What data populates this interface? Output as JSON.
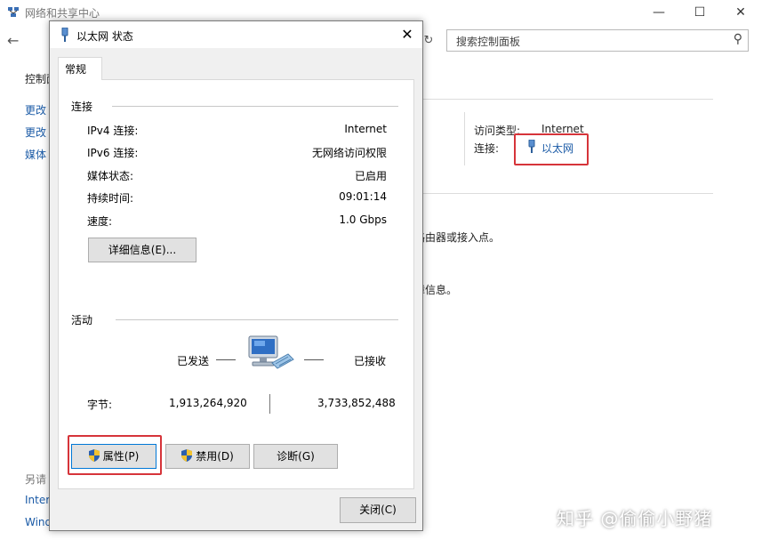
{
  "background": {
    "title": "网络和共享中心",
    "search_placeholder": "搜索控制面板",
    "left_items": [
      "控制面",
      "更改",
      "更改",
      "媒体"
    ],
    "left_bottom": [
      "另请",
      "Inter",
      "Wind"
    ],
    "access_type_label": "访问类型:",
    "access_type_value": "Internet",
    "connection_label": "连接:",
    "connection_value": "以太网",
    "text1": "路由器或接入点。",
    "text2": "障信息。"
  },
  "dialog": {
    "title": "以太网 状态",
    "tab": "常规",
    "connection": {
      "heading": "连接",
      "rows": [
        {
          "label": "IPv4 连接:",
          "value": "Internet"
        },
        {
          "label": "IPv6 连接:",
          "value": "无网络访问权限"
        },
        {
          "label": "媒体状态:",
          "value": "已启用"
        },
        {
          "label": "持续时间:",
          "value": "09:01:14"
        },
        {
          "label": "速度:",
          "value": "1.0 Gbps"
        }
      ],
      "details_button": "详细信息(E)..."
    },
    "activity": {
      "heading": "活动",
      "sent_label": "已发送",
      "received_label": "已接收",
      "bytes_label": "字节:",
      "bytes_sent": "1,913,264,920",
      "bytes_received": "3,733,852,488"
    },
    "buttons": {
      "properties": "属性(P)",
      "disable": "禁用(D)",
      "diagnose": "诊断(G)",
      "close": "关闭(C)"
    }
  },
  "watermark": "知乎 @偷偷小野猪",
  "colors": {
    "highlight_red": "#d6343a",
    "link_blue": "#1a5aa6",
    "button_face": "#e1e1e1",
    "dialog_face": "#f0f0f0"
  }
}
